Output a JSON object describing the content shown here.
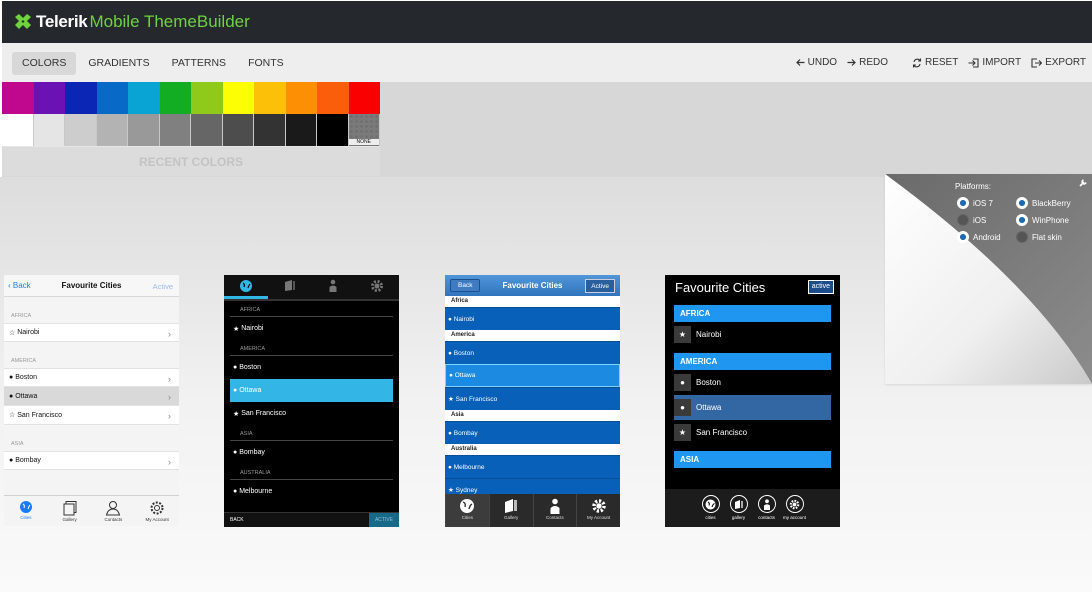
{
  "app": {
    "brand": "Telerik",
    "product": "Mobile ThemeBuilder",
    "accent": "#6ed33f"
  },
  "tabs": [
    {
      "label": "COLORS",
      "active": true
    },
    {
      "label": "GRADIENTS",
      "active": false
    },
    {
      "label": "PATTERNS",
      "active": false
    },
    {
      "label": "FONTS",
      "active": false
    }
  ],
  "actions": {
    "undo": "UNDO",
    "redo": "REDO",
    "reset": "RESET",
    "import": "IMPORT",
    "export": "EXPORT"
  },
  "palette": {
    "colors": [
      "#c0088f",
      "#6b12b4",
      "#0b25b5",
      "#0869c6",
      "#0aa4d4",
      "#13ad23",
      "#8fc91a",
      "#fdfd04",
      "#fcc009",
      "#fc8f03",
      "#fa5e0a",
      "#fb0000"
    ],
    "grays": [
      "#ffffff",
      "#e5e5e5",
      "#cdcdcd",
      "#b3b3b3",
      "#999999",
      "#808080",
      "#666666",
      "#4d4d4d",
      "#333333",
      "#1a1a1a",
      "#000000"
    ],
    "none_label": "NONE",
    "recent_label": "RECENT COLORS"
  },
  "ios": {
    "back": "Back",
    "title": "Favourite Cities",
    "active": "Active",
    "groups": [
      {
        "name": "AFRICA",
        "items": [
          {
            "label": "Nairobi",
            "icon": "star-outline-icon",
            "selected": false
          }
        ]
      },
      {
        "name": "AMERICA",
        "items": [
          {
            "label": "Boston",
            "icon": "globe-icon",
            "selected": false
          },
          {
            "label": "Ottawa",
            "icon": "globe-icon",
            "selected": true
          },
          {
            "label": "San Francisco",
            "icon": "star-outline-icon",
            "selected": false
          }
        ]
      },
      {
        "name": "ASIA",
        "items": [
          {
            "label": "Bombay",
            "icon": "globe-icon",
            "selected": false
          }
        ]
      }
    ],
    "tabbar": [
      {
        "label": "Cities",
        "icon": "globe-icon",
        "active": true
      },
      {
        "label": "Gallery",
        "icon": "gallery-icon",
        "active": false
      },
      {
        "label": "Contacts",
        "icon": "contacts-icon",
        "active": false
      },
      {
        "label": "My Account",
        "icon": "gear-icon",
        "active": false
      }
    ]
  },
  "android": {
    "groups": [
      {
        "name": "AFRICA",
        "items": [
          {
            "label": "Nairobi",
            "icon": "star-icon",
            "selected": false
          }
        ]
      },
      {
        "name": "AMERICA",
        "items": [
          {
            "label": "Boston",
            "icon": "globe-icon",
            "selected": false
          },
          {
            "label": "Ottawa",
            "icon": "globe-icon",
            "selected": true
          },
          {
            "label": "San Francisco",
            "icon": "star-icon",
            "selected": false
          }
        ]
      },
      {
        "name": "ASIA",
        "items": [
          {
            "label": "Bombay",
            "icon": "globe-icon",
            "selected": false
          }
        ]
      },
      {
        "name": "AUSTRALIA",
        "items": [
          {
            "label": "Melbourne",
            "icon": "globe-icon",
            "selected": false
          }
        ]
      }
    ],
    "back": "BACK",
    "active": "ACTIVE",
    "accent": "#33b5e5"
  },
  "blackberry": {
    "back": "Back",
    "title": "Favourite Cities",
    "active": "Active",
    "groups": [
      {
        "name": "Africa",
        "items": [
          {
            "label": "Nairobi",
            "selected": false
          }
        ]
      },
      {
        "name": "America",
        "items": [
          {
            "label": "Boston",
            "selected": false
          },
          {
            "label": "Ottawa",
            "selected": true
          },
          {
            "label": "San Francisco",
            "selected": false
          }
        ]
      },
      {
        "name": "Asia",
        "items": [
          {
            "label": "Bombay",
            "selected": false
          }
        ]
      },
      {
        "name": "Australia",
        "items": [
          {
            "label": "Melbourne",
            "selected": false
          },
          {
            "label": "Sydney",
            "selected": false
          }
        ]
      }
    ],
    "tabbar": [
      {
        "label": "Cities",
        "active": true
      },
      {
        "label": "Gallery",
        "active": false
      },
      {
        "label": "Contacts",
        "active": false
      },
      {
        "label": "My Account",
        "active": false
      }
    ]
  },
  "winphone": {
    "title": "Favourite Cities",
    "active": "active",
    "groups": [
      {
        "name": "AFRICA",
        "items": [
          {
            "label": "Nairobi",
            "icon": "star-icon",
            "selected": false
          }
        ]
      },
      {
        "name": "AMERICA",
        "items": [
          {
            "label": "Boston",
            "icon": "globe-icon",
            "selected": false
          },
          {
            "label": "Ottawa",
            "icon": "globe-icon",
            "selected": true
          },
          {
            "label": "San Francisco",
            "icon": "star-icon",
            "selected": false
          }
        ]
      },
      {
        "name": "ASIA",
        "items": []
      }
    ],
    "tabbar": [
      {
        "label": "cities",
        "icon": "globe-icon"
      },
      {
        "label": "gallery",
        "icon": "gallery-icon"
      },
      {
        "label": "contacts",
        "icon": "contacts-icon"
      },
      {
        "label": "my account",
        "icon": "gear-icon"
      }
    ]
  },
  "platforms": {
    "title": "Platforms:",
    "options": [
      {
        "label": "iOS 7",
        "checked": true
      },
      {
        "label": "BlackBerry",
        "checked": true
      },
      {
        "label": "iOS",
        "checked": false
      },
      {
        "label": "WinPhone",
        "checked": true
      },
      {
        "label": "Android",
        "checked": true
      },
      {
        "label": "Flat skin",
        "checked": false
      }
    ]
  }
}
